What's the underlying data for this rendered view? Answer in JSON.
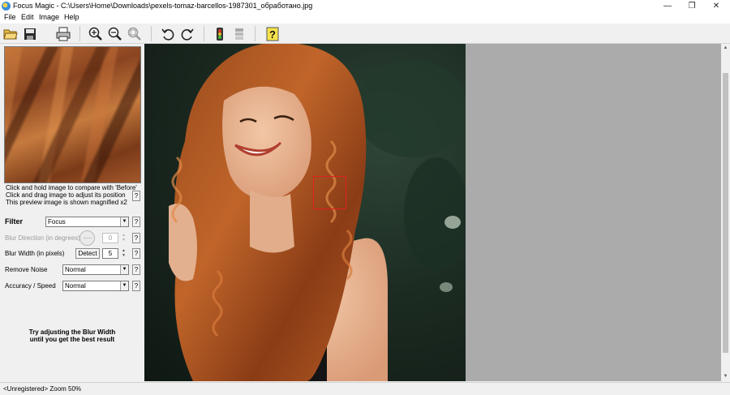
{
  "window": {
    "title": "Focus Magic - C:\\Users\\Home\\Downloads\\pexels-tomaz-barcellos-1987301_обработано.jpg",
    "min": "—",
    "max": "❐",
    "close": "✕"
  },
  "menu": [
    "File",
    "Edit",
    "Image",
    "Help"
  ],
  "toolbar": {
    "icons": [
      "open-folder-icon",
      "save-icon",
      "print-icon",
      "zoom-in-icon",
      "zoom-out-icon",
      "zoom-fit-icon",
      "rotate-left-icon",
      "rotate-right-icon",
      "traffic-light-icon",
      "batch-icon",
      "help-icon"
    ]
  },
  "preview": {
    "hints": [
      "Click and hold image to compare with 'Before'",
      "Click and drag image to adjust its position",
      "This preview image is shown magnified x2"
    ],
    "help": "?"
  },
  "controls": {
    "filter": {
      "label": "Filter",
      "value": "Focus"
    },
    "blur_direction": {
      "label": "Blur Direction (in degrees)",
      "value": "0"
    },
    "blur_width": {
      "label": "Blur Width (in pixels)",
      "detect": "Detect",
      "value": "5"
    },
    "remove_noise": {
      "label": "Remove Noise",
      "value": "Normal"
    },
    "accuracy": {
      "label": "Accuracy / Speed",
      "value": "Normal"
    },
    "help": "?",
    "arrow": "▼",
    "spin_up": "▲",
    "spin_down": "▼"
  },
  "tip": {
    "line1": "Try adjusting the Blur Width",
    "line2": "until you get the best result"
  },
  "status": {
    "text": "<Unregistered>  Zoom 50%"
  },
  "colors": {
    "selection": "#e02020",
    "canvas_bg": "#ababab",
    "window_bg": "#f0f0f0"
  }
}
